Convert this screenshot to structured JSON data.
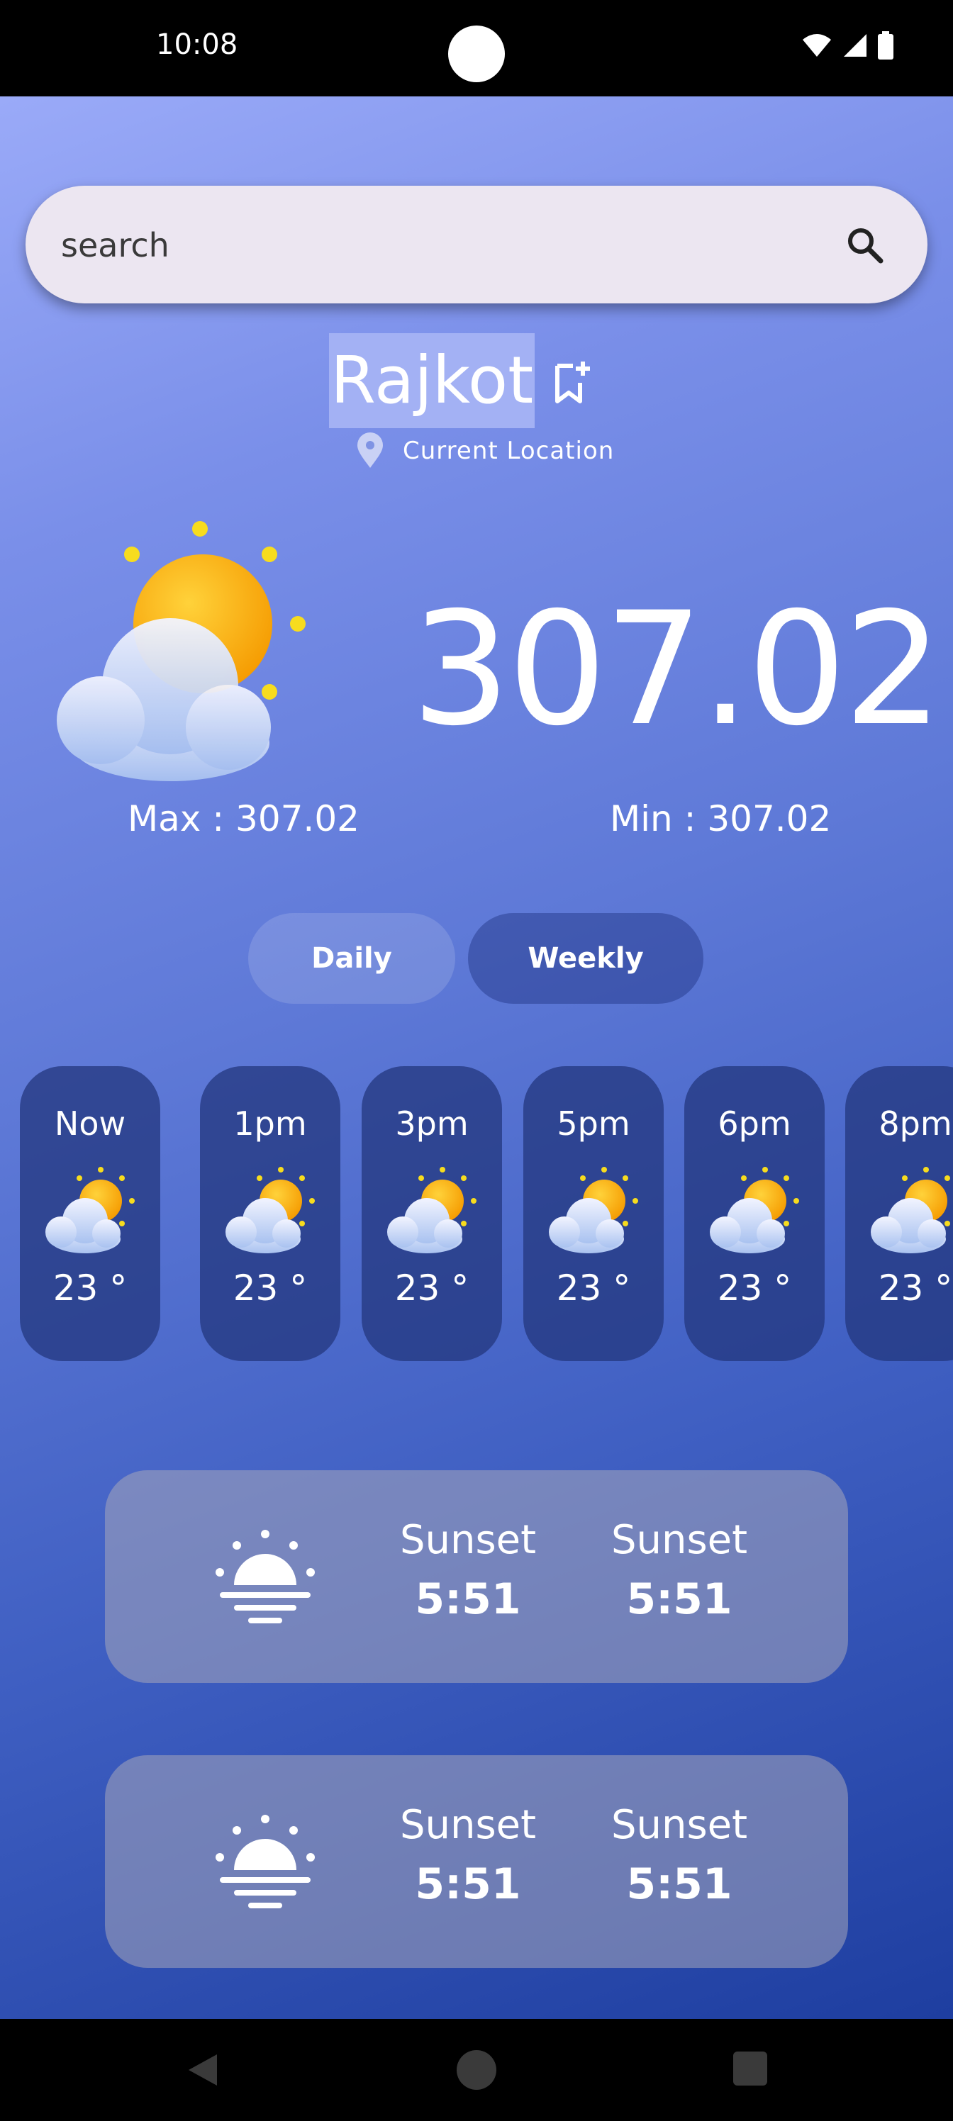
{
  "status_bar": {
    "time": "10:08"
  },
  "search": {
    "placeholder": "search"
  },
  "location": {
    "city": "Rajkot",
    "subtitle": "Current Location"
  },
  "current": {
    "temperature": "307.02°",
    "max": "Max : 307.02",
    "min": "Min : 307.02",
    "icon": "partly-cloudy-icon"
  },
  "tabs": [
    {
      "label": "Daily"
    },
    {
      "label": "Weekly"
    }
  ],
  "hourly": [
    {
      "label": "Now",
      "temp": "23 °"
    },
    {
      "label": "1pm",
      "temp": "23 °"
    },
    {
      "label": "3pm",
      "temp": "23 °"
    },
    {
      "label": "5pm",
      "temp": "23 °"
    },
    {
      "label": "6pm",
      "temp": "23 °"
    },
    {
      "label": "8pm",
      "temp": "23 °"
    }
  ],
  "sun_cards": [
    {
      "icon": "sunset-icon",
      "left_title": "Sunset",
      "left_value": "5:51",
      "right_title": "Sunset",
      "right_value": "5:51"
    },
    {
      "icon": "sunset-icon",
      "left_title": "Sunset",
      "left_value": "5:51",
      "right_title": "Sunset",
      "right_value": "5:51"
    }
  ],
  "colors": {
    "search_bg": "#ece6f1",
    "card_bg": "#23377d",
    "sun_yellow": "#f5b800"
  }
}
